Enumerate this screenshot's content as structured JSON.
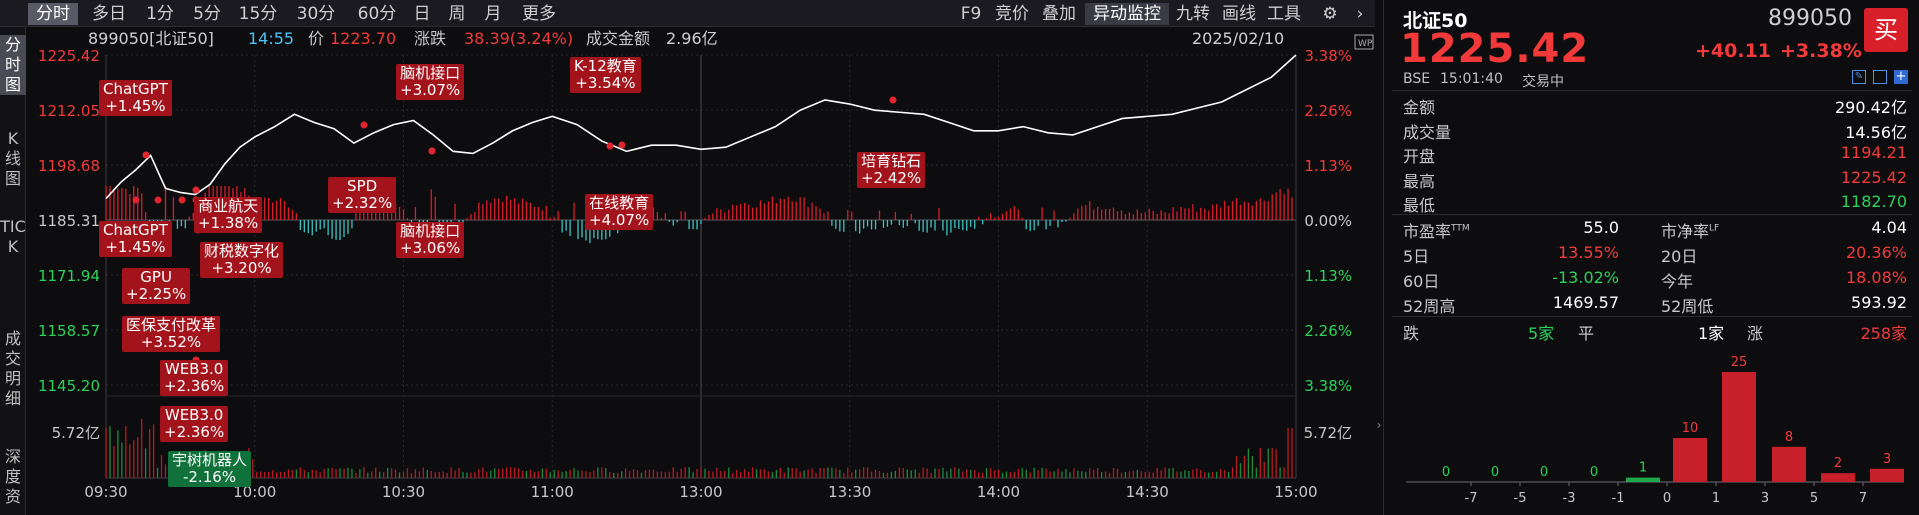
{
  "toolbar": {
    "periods": [
      "分时",
      "多日",
      "1分",
      "5分",
      "15分",
      "30分",
      "60分",
      "日",
      "周",
      "月",
      "更多"
    ],
    "tools": [
      "F9",
      "竞价",
      "叠加",
      "异动监控",
      "九转",
      "画线",
      "工具"
    ]
  },
  "left_tabs": [
    "分时图",
    "K线图",
    "TICK",
    "成交明细",
    "深度资"
  ],
  "info": {
    "code_name": "899050[北证50]",
    "time": "14:55",
    "price_label": "价",
    "price": "1223.70",
    "change_label": "涨跌",
    "change": "38.39(3.24%)",
    "turnover_label": "成交金额",
    "turnover": "2.96亿",
    "date": "2025/02/10"
  },
  "chart_data": {
    "type": "line",
    "y_axis_left": [
      "1225.42",
      "1212.05",
      "1198.68",
      "1185.31",
      "1171.94",
      "1158.57",
      "1145.20",
      "5.72亿"
    ],
    "y_axis_right": [
      "3.38%",
      "2.26%",
      "1.13%",
      "0.00%",
      "1.13%",
      "2.26%",
      "3.38%",
      "5.72亿"
    ],
    "x_ticks": [
      "09:30",
      "10:00",
      "10:30",
      "11:00",
      "13:00",
      "13:30",
      "14:00",
      "14:30",
      "15:00"
    ],
    "prev_close": 1185.31,
    "ylim": [
      1145.2,
      1225.42
    ],
    "price_series": {
      "x": [
        0,
        3,
        6,
        9,
        12,
        15,
        18,
        21,
        24,
        27,
        30,
        34,
        38,
        42,
        46,
        50,
        54,
        58,
        62,
        66,
        70,
        74,
        78,
        82,
        86,
        90,
        95,
        100,
        105,
        110,
        115,
        120,
        125,
        130,
        135,
        140,
        145,
        150,
        155,
        160,
        165,
        170,
        175,
        180,
        185,
        190,
        195,
        200,
        205,
        210,
        215,
        220,
        225,
        230,
        235,
        240
      ],
      "y": [
        1190.5,
        1194.5,
        1197.5,
        1201.0,
        1193.0,
        1192.0,
        1191.5,
        1194.0,
        1199.0,
        1203.0,
        1205.5,
        1208.0,
        1211.0,
        1209.0,
        1207.5,
        1204.0,
        1206.5,
        1208.5,
        1209.5,
        1206.0,
        1202.0,
        1201.5,
        1204.0,
        1207.0,
        1209.0,
        1210.5,
        1208.5,
        1204.5,
        1202.0,
        1203.5,
        1203.5,
        1202.5,
        1203.0,
        1205.5,
        1208.0,
        1212.0,
        1214.5,
        1213.5,
        1212.0,
        1211.5,
        1211.0,
        1209.0,
        1207.0,
        1207.0,
        1208.0,
        1206.5,
        1206.0,
        1208.0,
        1210.0,
        1210.5,
        1211.0,
        1212.5,
        1214.0,
        1217.0,
        1220.0,
        1225.42
      ]
    },
    "annotations": [
      {
        "label": "ChatGPT",
        "pct": "+1.45%",
        "color": "red"
      },
      {
        "label": "ChatGPT",
        "pct": "+1.45%",
        "color": "red"
      },
      {
        "label": "GPU",
        "pct": "+2.25%",
        "color": "red"
      },
      {
        "label": "医保支付改革",
        "pct": "+3.52%",
        "color": "red"
      },
      {
        "label": "WEB3.0",
        "pct": "+2.36%",
        "color": "red"
      },
      {
        "label": "WEB3.0",
        "pct": "+2.36%",
        "color": "red"
      },
      {
        "label": "宇树机器人",
        "pct": "-2.16%",
        "color": "green"
      },
      {
        "label": "商业航天",
        "pct": "+1.38%",
        "color": "red"
      },
      {
        "label": "财税数字化",
        "pct": "+3.20%",
        "color": "red"
      },
      {
        "label": "SPD",
        "pct": "+2.32%",
        "color": "red"
      },
      {
        "label": "脑机接口",
        "pct": "+3.07%",
        "color": "red"
      },
      {
        "label": "脑机接口",
        "pct": "+3.06%",
        "color": "red"
      },
      {
        "label": "K-12教育",
        "pct": "+3.54%",
        "color": "red"
      },
      {
        "label": "在线教育",
        "pct": "+4.07%",
        "color": "red"
      },
      {
        "label": "培育钻石",
        "pct": "+2.42%",
        "color": "red"
      }
    ]
  },
  "quote": {
    "name": "北证50",
    "code": "899050",
    "buy_label": "买",
    "price": "1225.42",
    "change": "+40.11",
    "change_pct": "+3.38%",
    "exchange": "BSE",
    "time": "15:01:40",
    "status": "交易中",
    "rows": [
      {
        "label": "金额",
        "value": "290.42亿",
        "color": "white"
      },
      {
        "label": "成交量",
        "value": "14.56亿",
        "color": "white"
      },
      {
        "label": "开盘",
        "value": "1194.21",
        "color": "red"
      },
      {
        "label": "最高",
        "value": "1225.42",
        "color": "red"
      },
      {
        "label": "最低",
        "value": "1182.70",
        "color": "green"
      }
    ],
    "pe_label": "市盈率",
    "pe_sup": "TTM",
    "pe": "55.0",
    "pb_label": "市净率",
    "pb_sup": "LF",
    "pb": "4.04",
    "d5_label": "5日",
    "d5": "13.55%",
    "d20_label": "20日",
    "d20": "20.36%",
    "d60_label": "60日",
    "d60": "-13.02%",
    "ytd_label": "今年",
    "ytd": "18.08%",
    "h52_label": "52周高",
    "h52": "1469.57",
    "l52_label": "52周低",
    "l52": "593.92",
    "down_label": "跌",
    "down": "5家",
    "flat_label": "平",
    "flat": "1家",
    "up_label": "涨",
    "up": "258家"
  },
  "dist_chart": {
    "type": "bar",
    "x_ticks": [
      "-7",
      "-5",
      "-3",
      "-1",
      "0",
      "1",
      "3",
      "5",
      "7"
    ],
    "values": [
      0,
      0,
      0,
      0,
      1,
      10,
      25,
      8,
      2,
      3
    ],
    "colors": [
      "green",
      "green",
      "green",
      "green",
      "green",
      "red",
      "red",
      "red",
      "red",
      "red"
    ]
  }
}
